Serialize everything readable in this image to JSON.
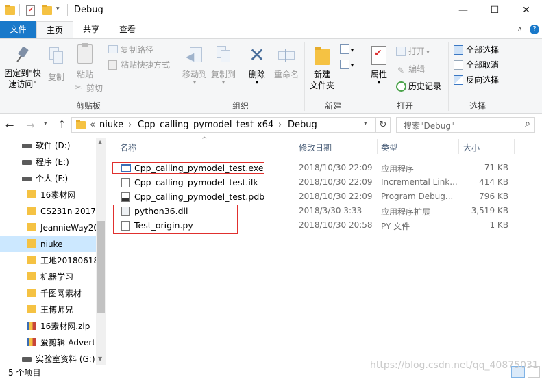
{
  "window": {
    "title": "Debug",
    "controls": {
      "minimize": "—",
      "maximize": "☐",
      "close": "✕"
    }
  },
  "ribbon_tabs": {
    "file": "文件",
    "home": "主页",
    "share": "共享",
    "view": "查看"
  },
  "ribbon": {
    "clipboard": {
      "pin": "固定到\"快\n速访问\"",
      "copy": "复制",
      "paste": "粘贴",
      "copy_path": "复制路径",
      "paste_shortcut": "粘贴快捷方式",
      "cut": "剪切",
      "group": "剪贴板"
    },
    "organize": {
      "move_to": "移动到",
      "copy_to": "复制到",
      "delete": "删除",
      "rename": "重命名",
      "group": "组织"
    },
    "new": {
      "new_folder": "新建\n文件夹",
      "group": "新建"
    },
    "open": {
      "properties": "属性",
      "open": "打开",
      "edit": "编辑",
      "history": "历史记录",
      "group": "打开"
    },
    "select": {
      "select_all": "全部选择",
      "select_none": "全部取消",
      "invert": "反向选择",
      "group": "选择"
    }
  },
  "address": {
    "crumbs": [
      "«",
      "niuke",
      "Cpp_calling_pymodel_test",
      "x64",
      "Debug"
    ],
    "separator": "›",
    "search_placeholder": "搜索\"Debug\""
  },
  "nav": [
    {
      "label": "软件 (D:)",
      "icon": "drive-icon",
      "indent": 1
    },
    {
      "label": "程序 (E:)",
      "icon": "drive-icon",
      "indent": 1
    },
    {
      "label": "个人 (F:)",
      "icon": "drive-icon",
      "indent": 1
    },
    {
      "label": "16素材网",
      "icon": "folder-icon",
      "indent": 2
    },
    {
      "label": "CS231n 2017",
      "icon": "folder-icon",
      "indent": 2
    },
    {
      "label": "JeannieWay20",
      "icon": "folder-icon",
      "indent": 2
    },
    {
      "label": "niuke",
      "icon": "folder-icon",
      "indent": 2,
      "selected": true
    },
    {
      "label": "工地20180618",
      "icon": "folder-icon",
      "indent": 2
    },
    {
      "label": "机器学习",
      "icon": "folder-icon",
      "indent": 2
    },
    {
      "label": "千图网素材",
      "icon": "folder-icon",
      "indent": 2
    },
    {
      "label": "王博师兄",
      "icon": "folder-icon",
      "indent": 2
    },
    {
      "label": "16素材网.zip",
      "icon": "zip-icon",
      "indent": 2
    },
    {
      "label": "爱剪辑-Advert",
      "icon": "zip-icon",
      "indent": 2
    },
    {
      "label": "实验室资料 (G:)",
      "icon": "drive-icon",
      "indent": 1
    }
  ],
  "columns": {
    "name": "名称",
    "date": "修改日期",
    "type": "类型",
    "size": "大小"
  },
  "files": [
    {
      "name": "Cpp_calling_pymodel_test.exe",
      "date": "2018/10/30 22:09",
      "type": "应用程序",
      "size": "71 KB",
      "icon": "exe-icon"
    },
    {
      "name": "Cpp_calling_pymodel_test.ilk",
      "date": "2018/10/30 22:09",
      "type": "Incremental Link...",
      "size": "414 KB",
      "icon": "file-icon"
    },
    {
      "name": "Cpp_calling_pymodel_test.pdb",
      "date": "2018/10/30 22:09",
      "type": "Program Debug...",
      "size": "796 KB",
      "icon": "pdb-icon"
    },
    {
      "name": "python36.dll",
      "date": "2018/3/30 3:33",
      "type": "应用程序扩展",
      "size": "3,519 KB",
      "icon": "dll-icon"
    },
    {
      "name": "Test_origin.py",
      "date": "2018/10/30 20:58",
      "type": "PY 文件",
      "size": "1 KB",
      "icon": "file-icon"
    }
  ],
  "status": {
    "count": "5 个项目"
  },
  "watermark": "https://blog.csdn.net/qq_40875031"
}
